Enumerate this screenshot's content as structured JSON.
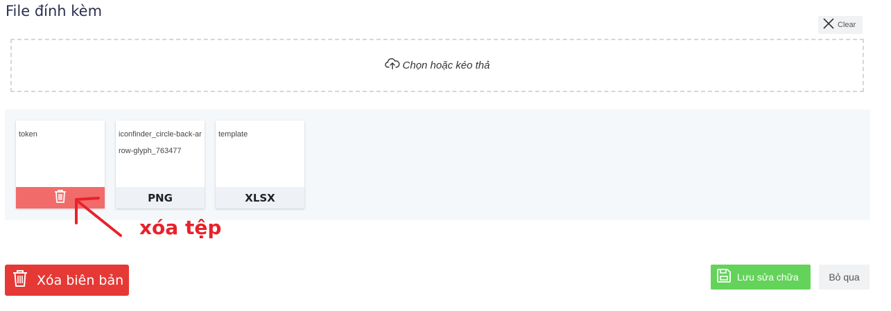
{
  "section": {
    "title": "File đính kèm"
  },
  "clear": {
    "label": "Clear",
    "icon": "close-icon"
  },
  "dropzone": {
    "label": "Chọn hoặc kéo thả",
    "icon": "cloud-upload-icon"
  },
  "files": [
    {
      "name": "token",
      "action": "delete",
      "icon": "trash-icon"
    },
    {
      "name": "iconfinder_circle-back-arrow-glyph_763477",
      "ext": "PNG"
    },
    {
      "name": "template",
      "ext": "XLSX"
    }
  ],
  "annotation": {
    "text": "xóa tệp",
    "color": "#e8222a"
  },
  "footer": {
    "delete_record_label": "Xóa biên bản",
    "save_label": "Lưu sửa chữa",
    "skip_label": "Bỏ qua"
  },
  "colors": {
    "danger": "#e53935",
    "danger_light": "#f26b6b",
    "success": "#63d35a",
    "title": "#2b3050",
    "file_area_bg": "#f5f8fb"
  }
}
